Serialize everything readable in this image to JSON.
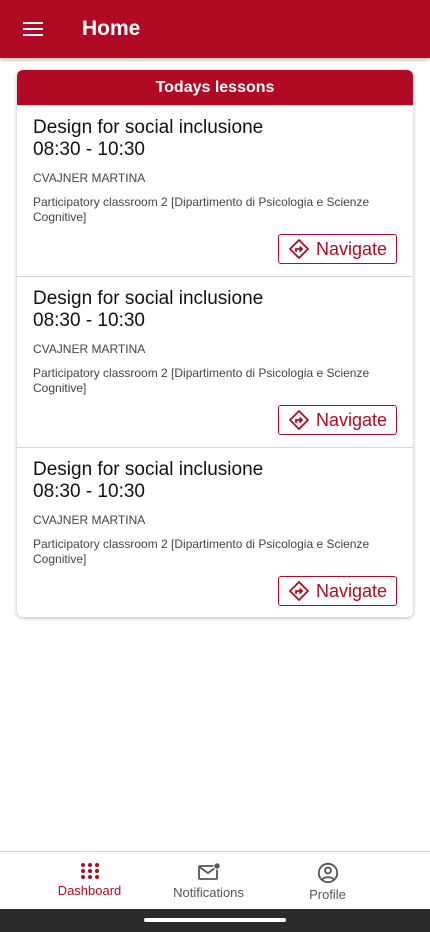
{
  "app_bar": {
    "title": "Home",
    "menu_icon": "menu-icon"
  },
  "lessons_card": {
    "header": "Todays lessons",
    "lessons": [
      {
        "title": "Design for social inclusione",
        "time": "08:30 - 10:30",
        "teacher": "CVAJNER MARTINA",
        "room": "Participatory classroom 2 [Dipartimento di Psicologia e Scienze Cognitive]",
        "navigate_label": "Navigate",
        "navigate_icon": "directions-icon"
      },
      {
        "title": "Design for social inclusione",
        "time": "08:30 - 10:30",
        "teacher": "CVAJNER MARTINA",
        "room": "Participatory classroom 2 [Dipartimento di Psicologia e Scienze Cognitive]",
        "navigate_label": "Navigate",
        "navigate_icon": "directions-icon"
      },
      {
        "title": "Design for social inclusione",
        "time": "08:30 - 10:30",
        "teacher": "CVAJNER MARTINA",
        "room": "Participatory classroom 2 [Dipartimento di Psicologia e Scienze Cognitive]",
        "navigate_label": "Navigate",
        "navigate_icon": "directions-icon"
      }
    ]
  },
  "bottom_nav": {
    "items": [
      {
        "label": "Dashboard",
        "icon": "dashboard-grid-icon",
        "active": true
      },
      {
        "label": "Notifications",
        "icon": "mail-notification-icon",
        "active": false
      },
      {
        "label": "Profile",
        "icon": "account-circle-icon",
        "active": false
      }
    ]
  },
  "colors": {
    "primary": "#b10a24",
    "text": "#111111",
    "secondary_text": "#444444",
    "divider": "#d4d4d4",
    "system_bar": "#2b2b2b"
  }
}
